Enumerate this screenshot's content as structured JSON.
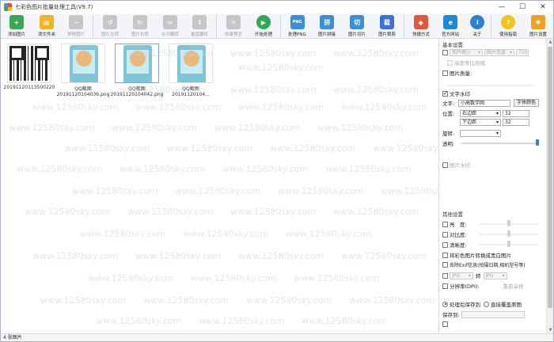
{
  "app": {
    "title": "七彩色图片批量处理工具(V9.7)"
  },
  "window_controls": {
    "minimize": "—",
    "maximize": "☐",
    "close": "✕"
  },
  "toolbar": [
    {
      "label": "添加图片",
      "icon": "add-image-icon",
      "color": "#3aa757",
      "glyph": "+",
      "enabled": true
    },
    {
      "label": "添文件夹",
      "icon": "add-folder-icon",
      "color": "#f0b429",
      "glyph": "▤",
      "enabled": true
    },
    {
      "label": "移除图片",
      "icon": "remove-image-icon",
      "color": "#8a8f98",
      "glyph": "−",
      "enabled": false
    },
    {
      "sep": true
    },
    {
      "label": "图片左转",
      "icon": "rotate-left-icon",
      "color": "#8a8f98",
      "glyph": "↺",
      "enabled": false
    },
    {
      "label": "图片右转",
      "icon": "rotate-right-icon",
      "color": "#8a8f98",
      "glyph": "↻",
      "enabled": false
    },
    {
      "label": "水平翻转",
      "icon": "flip-horizontal-icon",
      "color": "#8a8f98",
      "glyph": "⇔",
      "enabled": false
    },
    {
      "label": "垂直翻转",
      "icon": "flip-vertical-icon",
      "color": "#8a8f98",
      "glyph": "⇕",
      "enabled": false
    },
    {
      "sep": true
    },
    {
      "label": "效果预览",
      "icon": "preview-icon",
      "color": "#8a8f98",
      "glyph": "⌕",
      "enabled": false
    },
    {
      "label": "开始处理",
      "icon": "start-icon",
      "color": "#2fa84f",
      "glyph": "▶",
      "enabled": true,
      "round": true
    },
    {
      "sep": true
    },
    {
      "label": "处理PNG",
      "icon": "png-icon",
      "color": "#3b8fd9",
      "glyph": "PNG",
      "enabled": true
    },
    {
      "label": "图片拼接",
      "icon": "stitch-icon",
      "color": "#3b8fd9",
      "glyph": "拼",
      "enabled": true
    },
    {
      "label": "图片切片",
      "icon": "slice-icon",
      "color": "#3b8fd9",
      "glyph": "切",
      "enabled": true
    },
    {
      "label": "图片裁剪",
      "icon": "crop-icon",
      "color": "#3b6fd9",
      "glyph": "裁",
      "enabled": true
    },
    {
      "sep": true
    },
    {
      "label": "快捷方式",
      "icon": "shortcut-icon",
      "color": "#e0573b",
      "glyph": "◆",
      "enabled": true
    },
    {
      "label": "官方网站",
      "icon": "website-icon",
      "color": "#1e88d8",
      "glyph": "e",
      "enabled": true
    },
    {
      "label": "关于",
      "icon": "about-icon",
      "color": "#2f80d0",
      "glyph": "i",
      "enabled": true,
      "round": true
    },
    {
      "sep": true
    },
    {
      "label": "使用指南",
      "icon": "help-icon",
      "color": "#f2c318",
      "glyph": "?",
      "enabled": true,
      "round": true
    },
    {
      "label": "图片设置",
      "icon": "settings-icon",
      "color": "#f0a020",
      "glyph": "✱",
      "enabled": true
    }
  ],
  "thumbnails": [
    {
      "line1": "",
      "line2": "20191120113500220",
      "kind": "qr",
      "selected": false
    },
    {
      "line1": "QQ截图",
      "line2": "20191120104036.png",
      "kind": "phone",
      "selected": false
    },
    {
      "line1": "QQ截图",
      "line2": "20191120104042.png",
      "kind": "phone",
      "selected": true
    },
    {
      "line1": "QQ截图",
      "line2": "20191120104...",
      "kind": "phone",
      "selected": false
    }
  ],
  "watermark_text": "www.12580sky.com",
  "panel": {
    "basic_title": "基本设置",
    "resize_label": "图片缩小",
    "resize_mode": "图片宽度",
    "resize_value": "750",
    "keep_ratio": "高度等比例缩",
    "quality_label": "图片质量:",
    "text_watermark": "文字水印",
    "text_label": "文字:",
    "text_value": "小高数学网",
    "font_color_btn": "字体颜色",
    "position_label": "位置:",
    "pos_x_mode": "右边距",
    "pos_x_value": "32",
    "pos_y_mode": "下边距",
    "pos_y_value": "32",
    "rotate_label": "旋转:",
    "opacity_label": "透明:",
    "image_watermark": "图片水印",
    "other_title": "其他设置",
    "brightness": "亮　度:",
    "contrast": "对比度:",
    "saturation": "清晰度:",
    "grayscale": "将彩色图片转换成黑白图片",
    "remove_exif": "去除Exif信息(拍摄日期,相机型号等)",
    "convert_label": "转",
    "convert_from": "JPG",
    "convert_to": "JPG",
    "dpi_label": "分辨率(DPI):",
    "resample": "重新采样",
    "save_new": "处理后保存到",
    "overwrite": "直接覆盖原图",
    "save_to_label": "保存到:"
  },
  "status": {
    "count_text": "4 张图片"
  }
}
